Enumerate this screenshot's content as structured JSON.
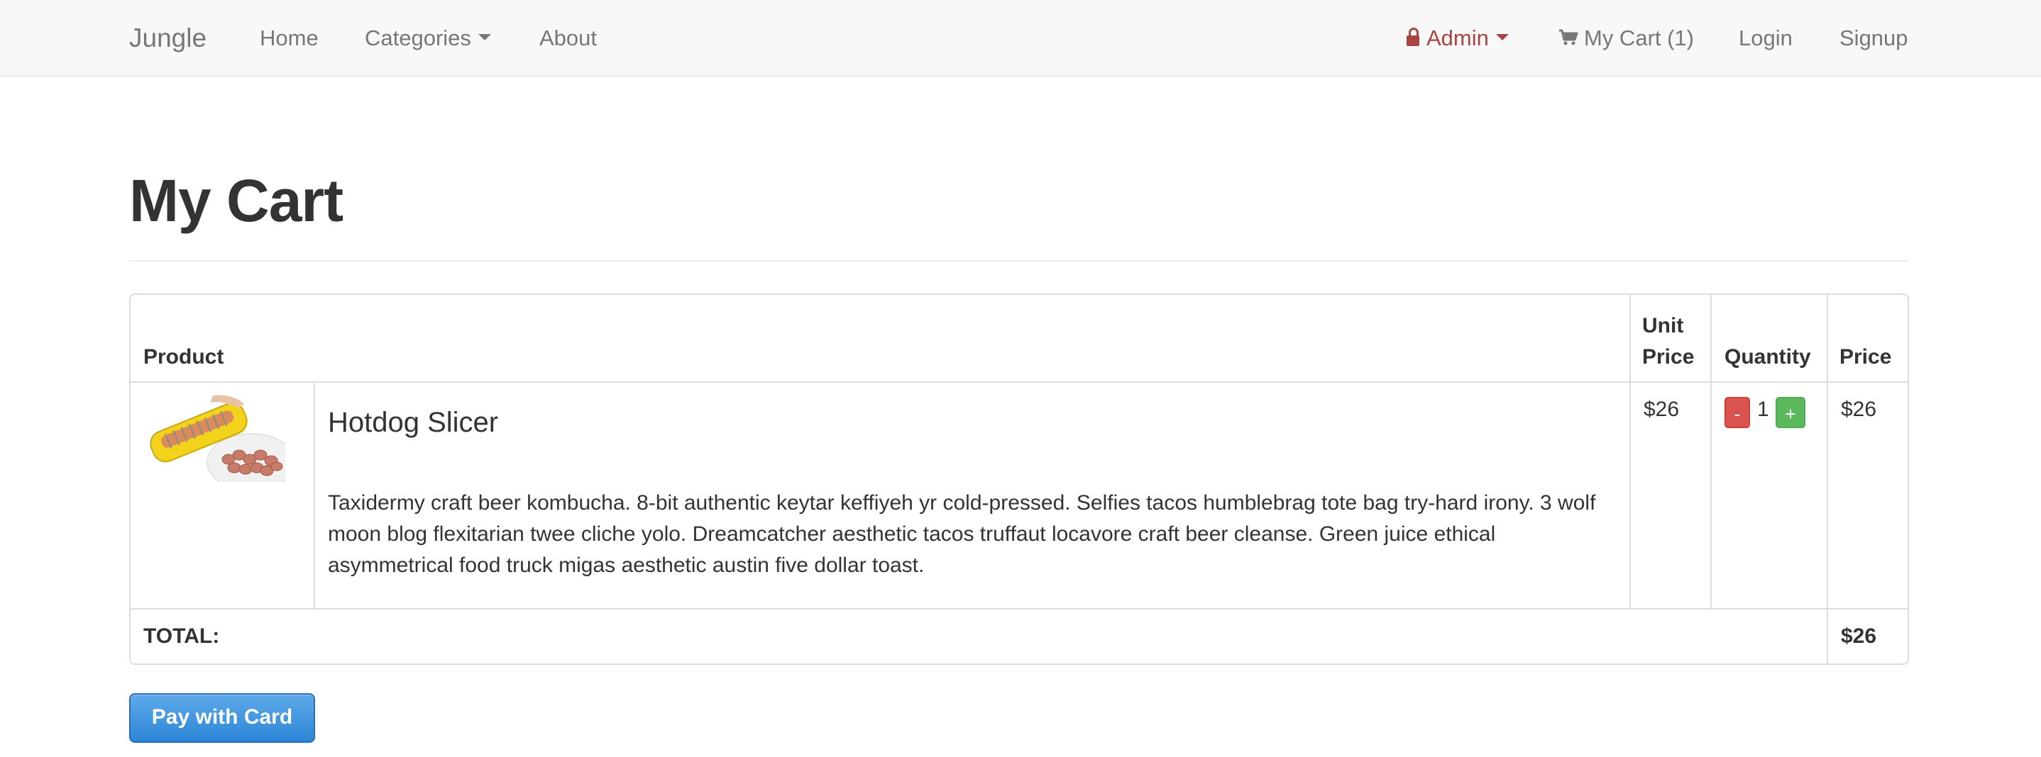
{
  "navbar": {
    "brand": "Jungle",
    "links": {
      "home": "Home",
      "categories": "Categories",
      "about": "About"
    },
    "admin": "Admin",
    "cart": "My Cart (1)",
    "login": "Login",
    "signup": "Signup"
  },
  "page": {
    "title": "My Cart"
  },
  "table": {
    "headers": {
      "product": "Product",
      "unit_price_1": "Unit",
      "unit_price_2": "Price",
      "quantity": "Quantity",
      "price": "Price"
    },
    "items": [
      {
        "name": "Hotdog Slicer",
        "description": "Taxidermy craft beer kombucha. 8-bit authentic keytar keffiyeh yr cold-pressed. Selfies tacos humblebrag tote bag try-hard irony. 3 wolf moon blog flexitarian twee cliche yolo. Dreamcatcher aesthetic tacos truffaut locavore craft beer cleanse. Green juice ethical asymmetrical food truck migas aesthetic austin five dollar toast.",
        "unit_price": "$26",
        "quantity": "1",
        "minus_label": "-",
        "plus_label": "+",
        "price": "$26"
      }
    ],
    "total_label": "TOTAL:",
    "total_value": "$26"
  },
  "pay_button": "Pay with Card",
  "colors": {
    "navbar_bg": "#f8f8f8",
    "admin": "#a94442",
    "minus_button": "#d9534f",
    "plus_button": "#5cb85c",
    "pay_button": "#3b93df"
  },
  "icons": {
    "admin": "lock-icon",
    "cart": "shopping-cart-icon",
    "dropdown": "caret-down-icon"
  }
}
